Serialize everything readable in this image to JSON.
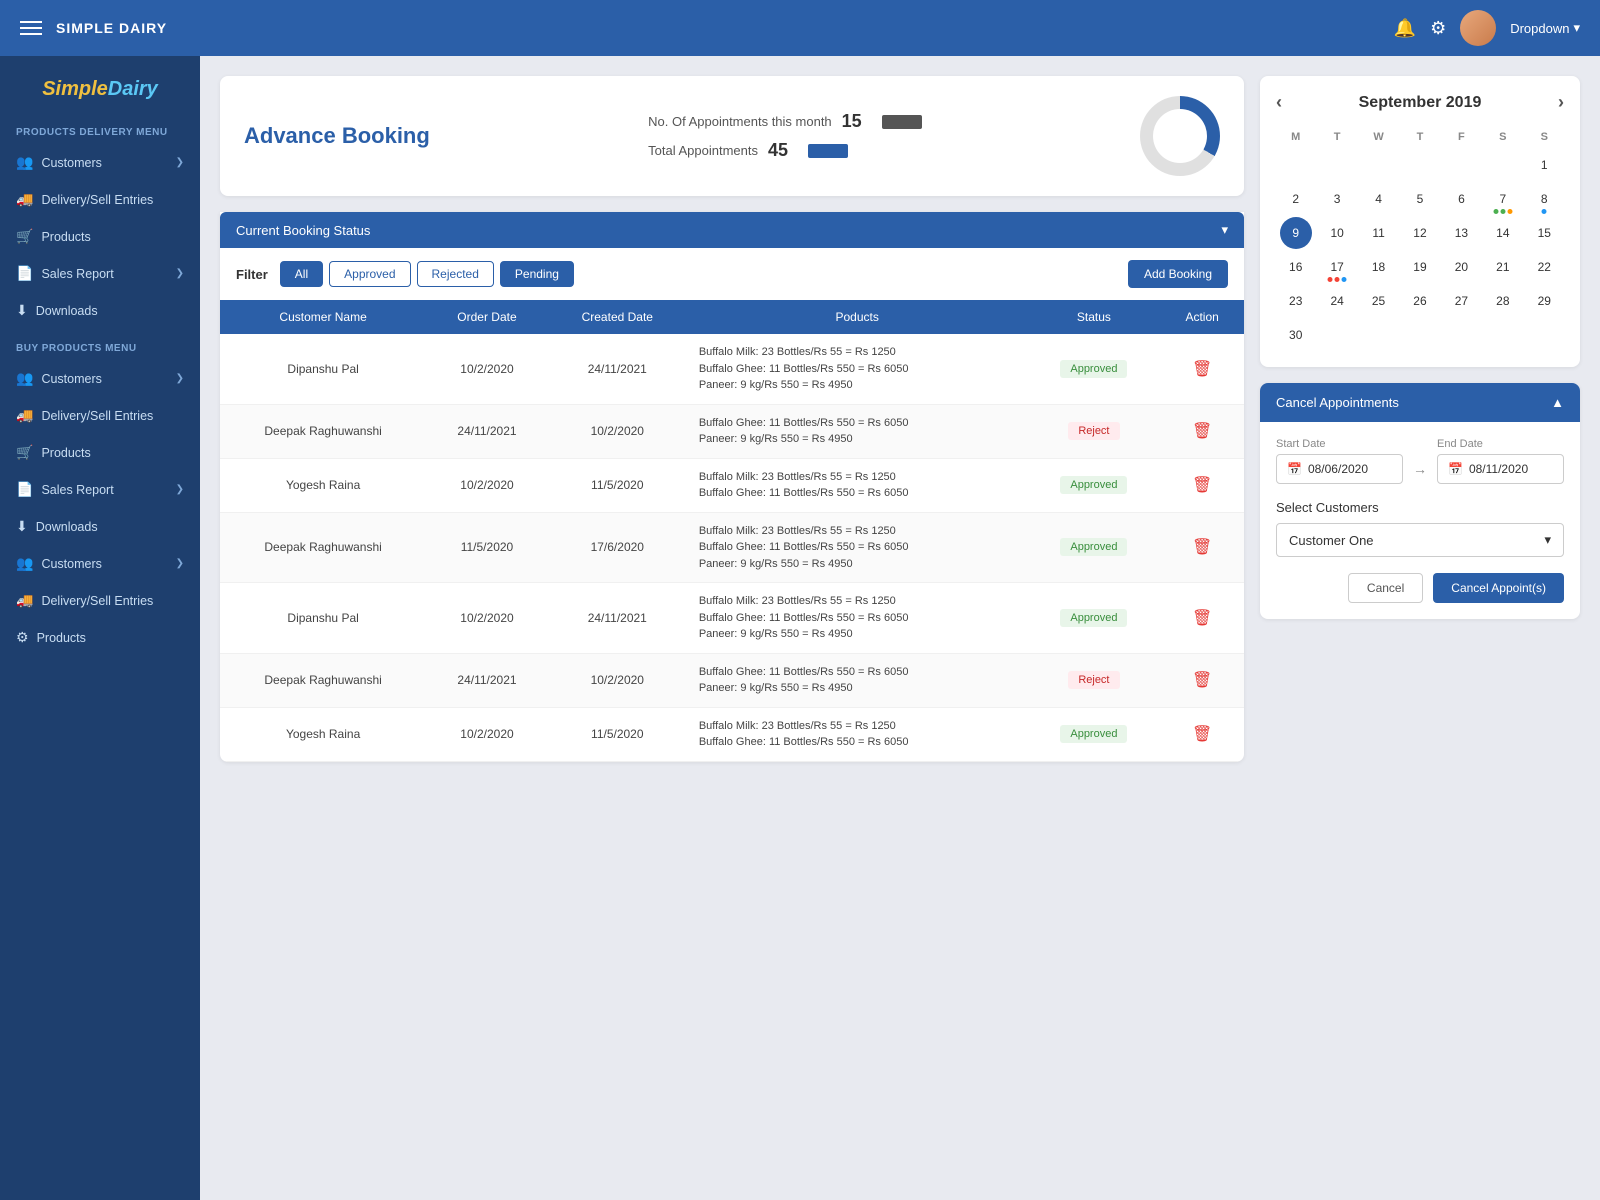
{
  "topbar": {
    "brand": "SIMPLE DAIRY",
    "dropdown_label": "Dropdown"
  },
  "sidebar": {
    "logo_text": "SimpleDairy",
    "sections": [
      {
        "title": "PRODUCTS DELIVERY MENU",
        "items": [
          {
            "label": "Customers",
            "icon": "customers-icon",
            "has_chevron": true
          },
          {
            "label": "Delivery/Sell Entries",
            "icon": "delivery-icon",
            "has_chevron": false
          },
          {
            "label": "Products",
            "icon": "products-icon",
            "has_chevron": false
          },
          {
            "label": "Sales Report",
            "icon": "sales-icon",
            "has_chevron": true
          },
          {
            "label": "Downloads",
            "icon": "downloads-icon",
            "has_chevron": false
          }
        ]
      },
      {
        "title": "BUY PRODUCTS MENU",
        "items": [
          {
            "label": "Customers",
            "icon": "customers-icon",
            "has_chevron": true
          },
          {
            "label": "Delivery/Sell Entries",
            "icon": "delivery-icon",
            "has_chevron": false
          },
          {
            "label": "Products",
            "icon": "products-icon",
            "has_chevron": false
          },
          {
            "label": "Sales Report",
            "icon": "sales-icon",
            "has_chevron": true
          },
          {
            "label": "Downloads",
            "icon": "downloads-icon",
            "has_chevron": false
          },
          {
            "label": "Customers",
            "icon": "customers-icon",
            "has_chevron": true
          },
          {
            "label": "Delivery/Sell Entries",
            "icon": "delivery-icon",
            "has_chevron": false
          },
          {
            "label": "Products",
            "icon": "products-icon",
            "has_chevron": false
          }
        ]
      }
    ]
  },
  "booking": {
    "title": "Advance Booking",
    "stats_label1": "No. Of Appointments this month",
    "stats_value1": "15",
    "stats_label2": "Total Appointments",
    "stats_value2": "45",
    "status_bar_label": "Current Booking Status",
    "filter_label": "Filter",
    "filter_buttons": [
      "All",
      "Approved",
      "Rejected",
      "Pending"
    ],
    "add_button": "Add Booking",
    "table_headers": [
      "Customer Name",
      "Order Date",
      "Created Date",
      "Poducts",
      "Status",
      "Action"
    ],
    "table_rows": [
      {
        "customer": "Dipanshu Pal",
        "order_date": "10/2/2020",
        "created_date": "24/11/2021",
        "products": "Buffalo Milk: 23 Bottles/Rs 55 = Rs 1250\nBuffalo Ghee: 11 Bottles/Rs 550 = Rs 6050\nPaneer: 9 kg/Rs 550 = Rs 4950",
        "status": "Approved"
      },
      {
        "customer": "Deepak Raghuwanshi",
        "order_date": "24/11/2021",
        "created_date": "10/2/2020",
        "products": "Buffalo Ghee: 11 Bottles/Rs 550 = Rs 6050\nPaneer: 9 kg/Rs 550 = Rs 4950",
        "status": "Reject"
      },
      {
        "customer": "Yogesh Raina",
        "order_date": "10/2/2020",
        "created_date": "11/5/2020",
        "products": "Buffalo Milk: 23 Bottles/Rs 55 = Rs 1250\nBuffalo Ghee: 11 Bottles/Rs 550 = Rs 6050",
        "status": "Approved"
      },
      {
        "customer": "Deepak Raghuwanshi",
        "order_date": "11/5/2020",
        "created_date": "17/6/2020",
        "products": "Buffalo Milk: 23 Bottles/Rs 55 = Rs 1250\nBuffalo Ghee: 11 Bottles/Rs 550 = Rs 6050\nPaneer: 9 kg/Rs 550 = Rs 4950",
        "status": "Approved"
      },
      {
        "customer": "Dipanshu Pal",
        "order_date": "10/2/2020",
        "created_date": "24/11/2021",
        "products": "Buffalo Milk: 23 Bottles/Rs 55 = Rs 1250\nBuffalo Ghee: 11 Bottles/Rs 550 = Rs 6050\nPaneer: 9 kg/Rs 550 = Rs 4950",
        "status": "Approved"
      },
      {
        "customer": "Deepak Raghuwanshi",
        "order_date": "24/11/2021",
        "created_date": "10/2/2020",
        "products": "Buffalo Ghee: 11 Bottles/Rs 550 = Rs 6050\nPaneer: 9 kg/Rs 550 = Rs 4950",
        "status": "Reject"
      },
      {
        "customer": "Yogesh Raina",
        "order_date": "10/2/2020",
        "created_date": "11/5/2020",
        "products": "Buffalo Milk: 23 Bottles/Rs 55 = Rs 1250\nBuffalo Ghee: 11 Bottles/Rs 550 = Rs 6050",
        "status": "Approved"
      }
    ]
  },
  "calendar": {
    "month_year": "September 2019",
    "day_labels": [
      "M",
      "T",
      "W",
      "T",
      "F",
      "S",
      "S"
    ],
    "today_date": 9,
    "cells": [
      {
        "day": "",
        "empty": true
      },
      {
        "day": "",
        "empty": true
      },
      {
        "day": "",
        "empty": true
      },
      {
        "day": "",
        "empty": true
      },
      {
        "day": "",
        "empty": true
      },
      {
        "day": "",
        "empty": true
      },
      {
        "day": "1"
      },
      {
        "day": "2"
      },
      {
        "day": "3"
      },
      {
        "day": "4"
      },
      {
        "day": "5"
      },
      {
        "day": "6"
      },
      {
        "day": "7",
        "dots": [
          "green",
          "green",
          "orange"
        ]
      },
      {
        "day": "8",
        "dots": [
          "blue"
        ]
      },
      {
        "day": "9",
        "today": true
      },
      {
        "day": "10"
      },
      {
        "day": "11"
      },
      {
        "day": "12"
      },
      {
        "day": "13"
      },
      {
        "day": "14"
      },
      {
        "day": "15"
      },
      {
        "day": "16"
      },
      {
        "day": "17",
        "dots": [
          "red",
          "red",
          "blue"
        ]
      },
      {
        "day": "18"
      },
      {
        "day": "19"
      },
      {
        "day": "20"
      },
      {
        "day": "21"
      },
      {
        "day": "22"
      },
      {
        "day": "23"
      },
      {
        "day": "24"
      },
      {
        "day": "25"
      },
      {
        "day": "26"
      },
      {
        "day": "27"
      },
      {
        "day": "28"
      },
      {
        "day": "29"
      },
      {
        "day": "30"
      }
    ]
  },
  "cancel_appointments": {
    "title": "Cancel Appointments",
    "start_date_label": "Start Date",
    "start_date_value": "08/06/2020",
    "end_date_label": "End Date",
    "end_date_value": "08/11/2020",
    "select_customers_label": "Select Customers",
    "customer_selected": "Customer One",
    "cancel_btn_label": "Cancel",
    "cancel_appt_btn_label": "Cancel Appoint(s)"
  }
}
